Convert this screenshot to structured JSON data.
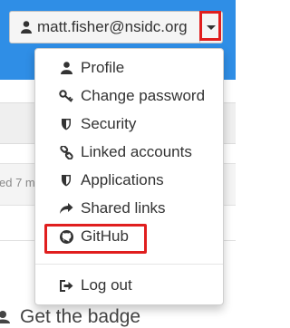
{
  "header": {
    "user_email": "matt.fisher@nsidc.org",
    "user_icon": "user-icon",
    "caret_icon": "caret-down-icon",
    "highlight_color": "#e01e1e",
    "accent_color": "#2f8ee6"
  },
  "menu": {
    "items": [
      {
        "label": "Profile",
        "icon": "user-icon"
      },
      {
        "label": "Change password",
        "icon": "key-icon"
      },
      {
        "label": "Security",
        "icon": "shield-icon"
      },
      {
        "label": "Linked accounts",
        "icon": "link-icon"
      },
      {
        "label": "Applications",
        "icon": "shield-icon"
      },
      {
        "label": "Shared links",
        "icon": "share-icon"
      },
      {
        "label": "GitHub",
        "icon": "github-icon"
      }
    ],
    "logout": {
      "label": "Log out",
      "icon": "sign-out-icon"
    }
  },
  "background": {
    "updated_fragment": "ed 7 m",
    "heading_fragment": "Get the badge"
  }
}
